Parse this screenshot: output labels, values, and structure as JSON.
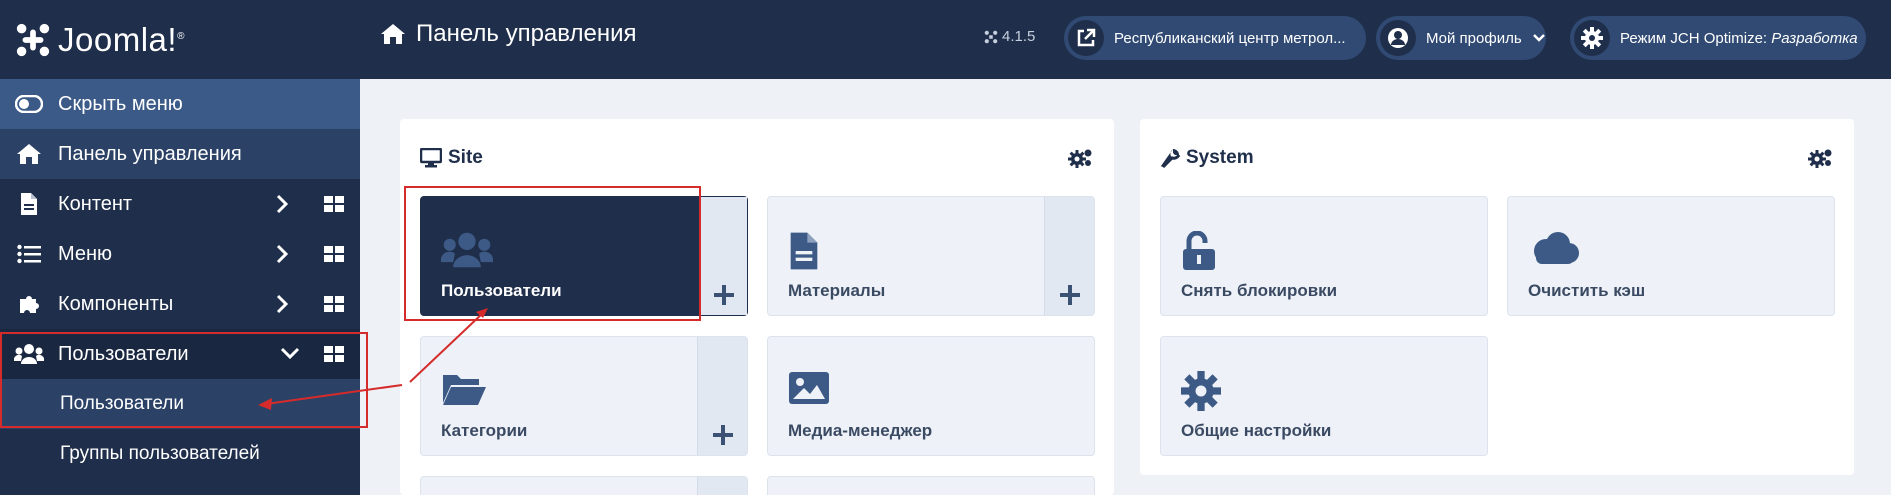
{
  "brand": {
    "name": "Joomla!",
    "reg": "®"
  },
  "sidebar": {
    "toggle_label": "Скрыть меню",
    "items": [
      {
        "label": "Панель управления"
      },
      {
        "label": "Контент"
      },
      {
        "label": "Меню"
      },
      {
        "label": "Компоненты"
      },
      {
        "label": "Пользователи"
      }
    ],
    "subitems": [
      {
        "label": "Пользователи"
      },
      {
        "label": "Группы пользователей"
      }
    ]
  },
  "header": {
    "title": "Панель управления",
    "version": "4.1.5",
    "site_link": "Республиканский центр метрол...",
    "profile": "Мой профиль",
    "jch_prefix": "Режим JCH Optimize: ",
    "jch_mode": "Разработка"
  },
  "site_card": {
    "title": "Site",
    "tiles": [
      {
        "label": "Пользователи"
      },
      {
        "label": "Материалы"
      },
      {
        "label": "Категории"
      },
      {
        "label": "Медиа-менеджер"
      }
    ]
  },
  "system_card": {
    "title": "System",
    "tiles": [
      {
        "label": "Снять блокировки"
      },
      {
        "label": "Очистить кэш"
      },
      {
        "label": "Общие настройки"
      }
    ]
  },
  "colors": {
    "sidebar": "#1f2e4a",
    "accent": "#304a73",
    "highlight": "#d62b2b"
  }
}
